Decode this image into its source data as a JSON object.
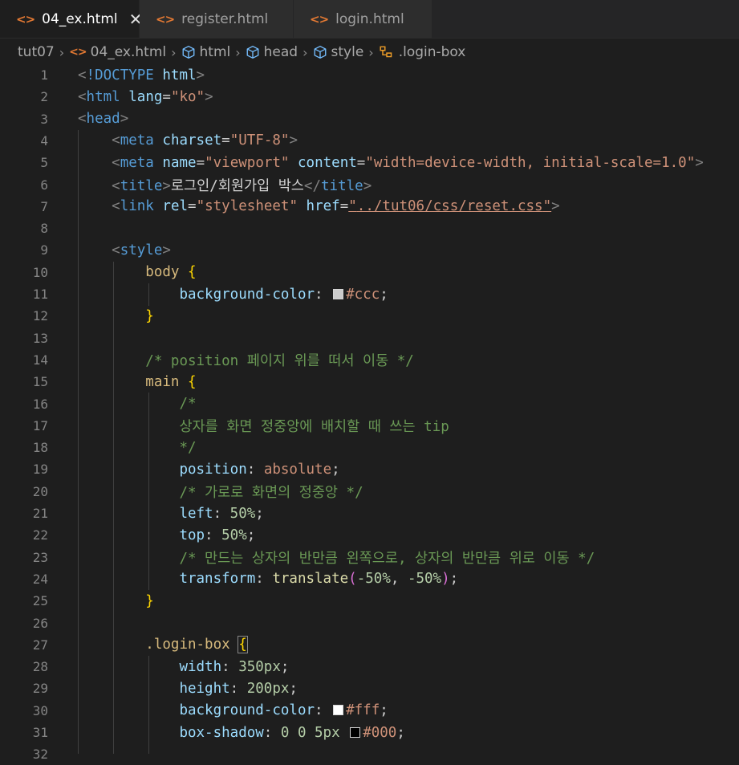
{
  "tabs": [
    {
      "label": "04_ex.html",
      "active": true,
      "icon": "html-file-icon"
    },
    {
      "label": "register.html",
      "active": false,
      "icon": "html-file-icon"
    },
    {
      "label": "login.html",
      "active": false,
      "icon": "html-file-icon"
    }
  ],
  "close_glyph": "✕",
  "file_icon_glyph": "<>",
  "breadcrumb": {
    "items": [
      "tut07",
      "04_ex.html",
      "html",
      "head",
      "style",
      ".login-box"
    ],
    "separator": "›"
  },
  "line_numbers": [
    "1",
    "2",
    "3",
    "4",
    "5",
    "6",
    "7",
    "8",
    "9",
    "10",
    "11",
    "12",
    "13",
    "14",
    "15",
    "16",
    "17",
    "18",
    "19",
    "20",
    "21",
    "22",
    "23",
    "24",
    "25",
    "26",
    "27",
    "28",
    "29",
    "30",
    "31",
    "32"
  ],
  "code": {
    "l1": {
      "doctype": "!DOCTYPE",
      "html": "html"
    },
    "l2": {
      "tag": "html",
      "attr": "lang",
      "val": "\"ko\""
    },
    "l3": {
      "tag": "head"
    },
    "l4": {
      "tag": "meta",
      "attr": "charset",
      "val": "\"UTF-8\""
    },
    "l5": {
      "tag": "meta",
      "attr1": "name",
      "val1": "\"viewport\"",
      "attr2": "content",
      "val2": "\"width=device-width, initial-scale=1.0\""
    },
    "l6": {
      "tag": "title",
      "text": "로그인/회원가입 박스"
    },
    "l7": {
      "tag": "link",
      "attr1": "rel",
      "val1": "\"stylesheet\"",
      "attr2": "href",
      "val2_q": "\"",
      "val2": "../tut06/css/reset.css"
    },
    "l9": {
      "tag": "style"
    },
    "l10": {
      "sel": "body",
      "brace": "{"
    },
    "l11": {
      "prop": "background-color",
      "val": "#ccc"
    },
    "l12": {
      "brace": "}"
    },
    "l14": {
      "cmt": "/* position 페이지 위를 떠서 이동 */"
    },
    "l15": {
      "sel": "main",
      "brace": "{"
    },
    "l16": {
      "cmt": "/*"
    },
    "l17": {
      "cmt": "상자를 화면 정중앙에 배치할 때 쓰는 tip"
    },
    "l18": {
      "cmt": "*/"
    },
    "l19": {
      "prop": "position",
      "val": "absolute"
    },
    "l20": {
      "cmt": "/* 가로로 화면의 정중앙 */"
    },
    "l21": {
      "prop": "left",
      "val": "50%"
    },
    "l22": {
      "prop": "top",
      "val": "50%"
    },
    "l23": {
      "cmt": "/* 만드는 상자의 반만큼 왼쪽으로, 상자의 반만큼 위로 이동 */"
    },
    "l24": {
      "prop": "transform",
      "fn": "translate",
      "arg1": "-50%",
      "arg2": "-50%"
    },
    "l25": {
      "brace": "}"
    },
    "l27": {
      "sel": ".login-box",
      "brace": "{"
    },
    "l28": {
      "prop": "width",
      "val": "350px"
    },
    "l29": {
      "prop": "height",
      "val": "200px"
    },
    "l30": {
      "prop": "background-color",
      "val": "#fff"
    },
    "l31": {
      "prop": "box-shadow",
      "val": "0 0 5px",
      "color": "#000"
    }
  },
  "swatches": {
    "ccc": "#cccccc",
    "fff": "#ffffff",
    "black": "#000000"
  },
  "colors": {
    "accent_html_icon": "#e37933",
    "editor_bg": "#1e1e1e"
  }
}
